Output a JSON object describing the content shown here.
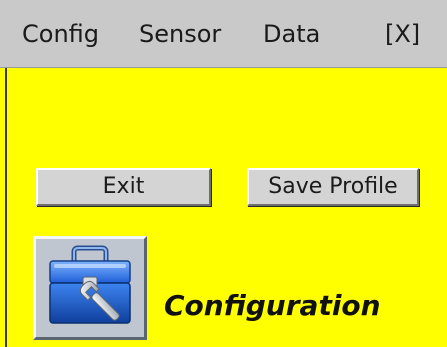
{
  "menubar": {
    "items": [
      {
        "label": "Config"
      },
      {
        "label": "Sensor"
      },
      {
        "label": "Data"
      },
      {
        "label": "[X]"
      }
    ]
  },
  "buttons": {
    "exit_label": "Exit",
    "save_profile_label": "Save Profile"
  },
  "config_panel": {
    "icon": "toolbox-wrench-icon",
    "label": "Configuration"
  },
  "colors": {
    "background": "#ffff00",
    "menubar": "#c9c9c9",
    "button_face": "#d4d4d4",
    "text": "#1a1a1a"
  }
}
